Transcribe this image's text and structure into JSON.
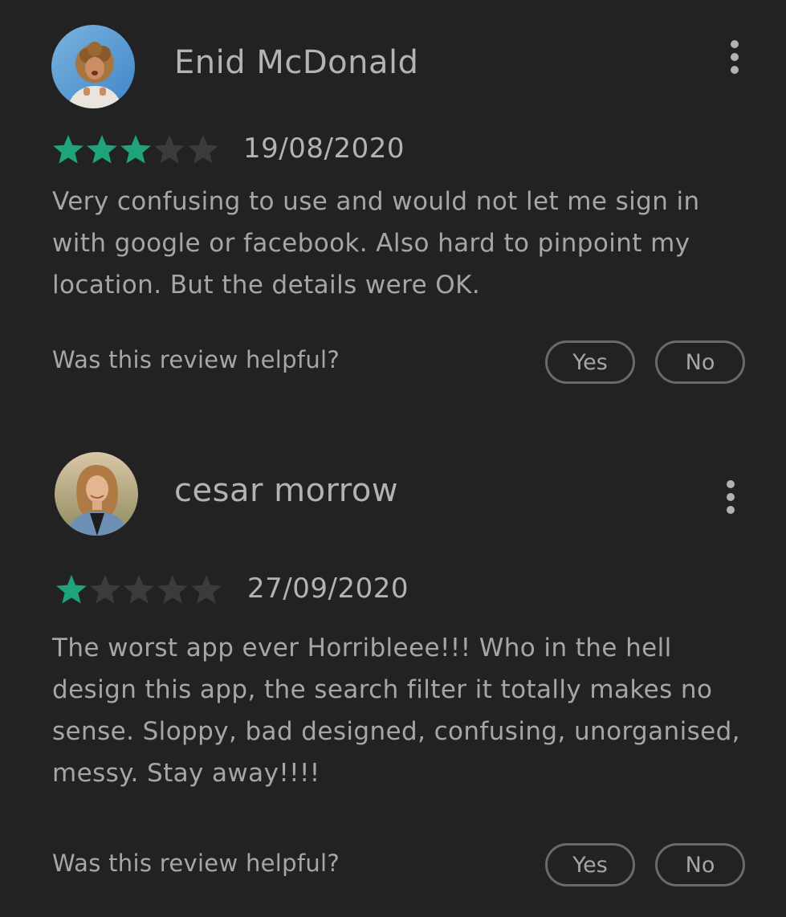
{
  "colors": {
    "background": "#222222",
    "star_filled": "#1fa37a",
    "star_empty": "#3b3b3b",
    "text": "#a6a6a6",
    "pill_border": "#6a6a6a"
  },
  "reviews": [
    {
      "reviewer_name": "Enid McDonald",
      "rating": 3,
      "max_rating": 5,
      "date": "19/08/2020",
      "text": "Very confusing to use and would not let me sign in with google or facebook. Also hard to pinpoint my location. But the details were OK.",
      "helpful_prompt": "Was this review helpful?",
      "yes_label": "Yes",
      "no_label": "No",
      "menu_icon": "more-vert-icon"
    },
    {
      "reviewer_name": "cesar morrow",
      "rating": 1,
      "max_rating": 5,
      "date": "27/09/2020",
      "text": "The worst app ever Horribleee!!! Who in the hell design this app, the search filter it totally makes no sense. Sloppy, bad designed, confusing, unorganised, messy. Stay away!!!!",
      "helpful_prompt": "Was this review helpful?",
      "yes_label": "Yes",
      "no_label": "No",
      "menu_icon": "more-vert-icon"
    }
  ]
}
